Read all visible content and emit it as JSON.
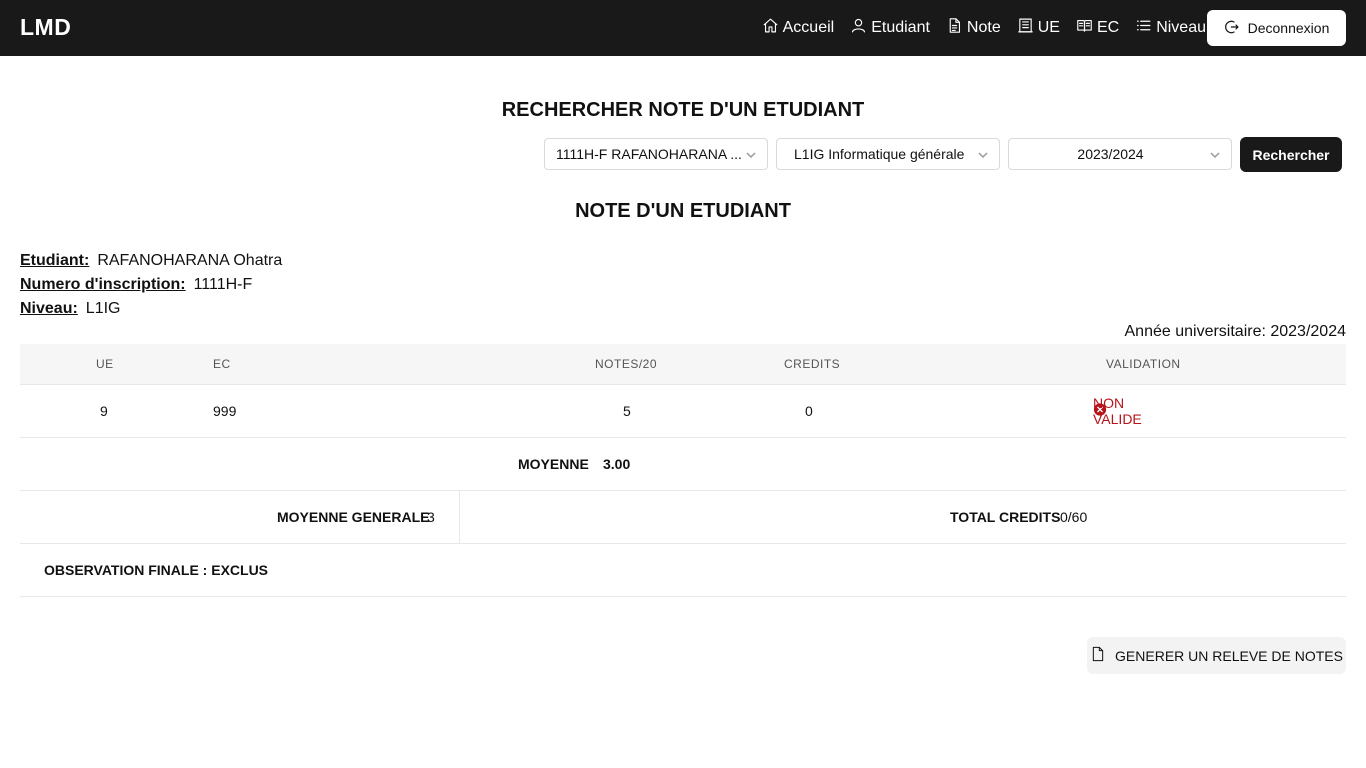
{
  "nav": {
    "brand": "LMD",
    "items": [
      {
        "label": "Accueil",
        "icon": "home-icon"
      },
      {
        "label": "Etudiant",
        "icon": "user-icon"
      },
      {
        "label": "Note",
        "icon": "document-icon"
      },
      {
        "label": "UE",
        "icon": "building-icon"
      },
      {
        "label": "EC",
        "icon": "book-icon"
      },
      {
        "label": "Niveau",
        "icon": "list-icon"
      }
    ],
    "logout_label": "Deconnexion",
    "logout_icon": "logout-icon"
  },
  "search": {
    "title": "RECHERCHER NOTE D'UN ETUDIANT",
    "student_select": "1111H-F RAFANOHARANA ...",
    "level_select": "L1IG Informatique générale",
    "year_select": "2023/2024",
    "button_label": "Rechercher"
  },
  "note": {
    "title": "NOTE D'UN ETUDIANT",
    "student_label": "Etudiant:",
    "student_value": "RAFANOHARANA Ohatra",
    "inscription_label": "Numero d'inscription:",
    "inscription_value": "1111H-F",
    "level_label": "Niveau:",
    "level_value": "L1IG",
    "year_text": "Année universitaire: 2023/2024"
  },
  "table": {
    "headers": {
      "ue": "UE",
      "ec": "EC",
      "notes": "NOTES/20",
      "credits": "CREDITS",
      "validation": "VALIDATION"
    },
    "rows": [
      {
        "ue": "9",
        "ec": "999",
        "notes": "5",
        "credits": "0",
        "validation": "NON VALIDE"
      }
    ],
    "moyenne_label": "MOYENNE",
    "moyenne_value": "3.00",
    "moyenne_generale_label": "MOYENNE GENERALE",
    "moyenne_generale_value": "3",
    "total_credits_label": "TOTAL CREDITS",
    "total_credits_value": "0/60",
    "observation": "OBSERVATION FINALE : EXCLUS"
  },
  "generate_button": "GENERER UN RELEVE DE NOTES",
  "colors": {
    "navbar": "#191919",
    "invalid": "#b4141a",
    "header_bg": "#f6f6f7"
  }
}
